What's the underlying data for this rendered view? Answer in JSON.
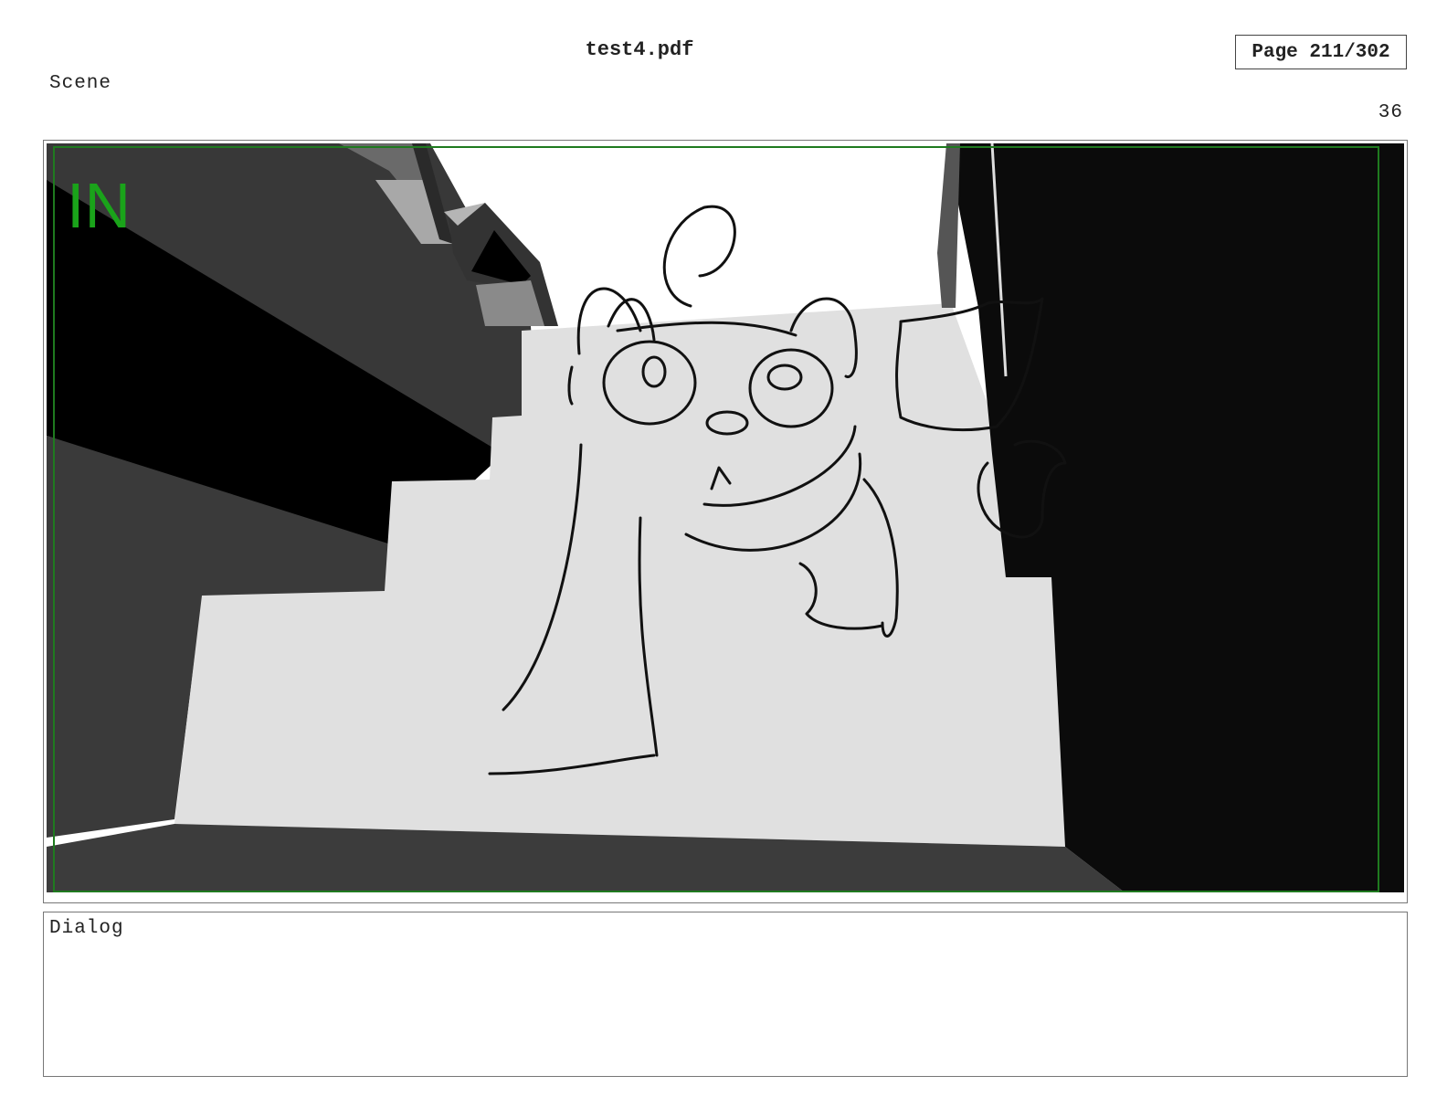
{
  "header": {
    "file_name": "test4.pdf",
    "page_indicator": "Page 211/302"
  },
  "scene": {
    "label": "Scene",
    "number": "36"
  },
  "panel": {
    "camera_tag": "IN",
    "tag_color": "#1aa31a",
    "safe_frame_color": "#1f7a1f"
  },
  "dialog": {
    "label": "Dialog"
  }
}
